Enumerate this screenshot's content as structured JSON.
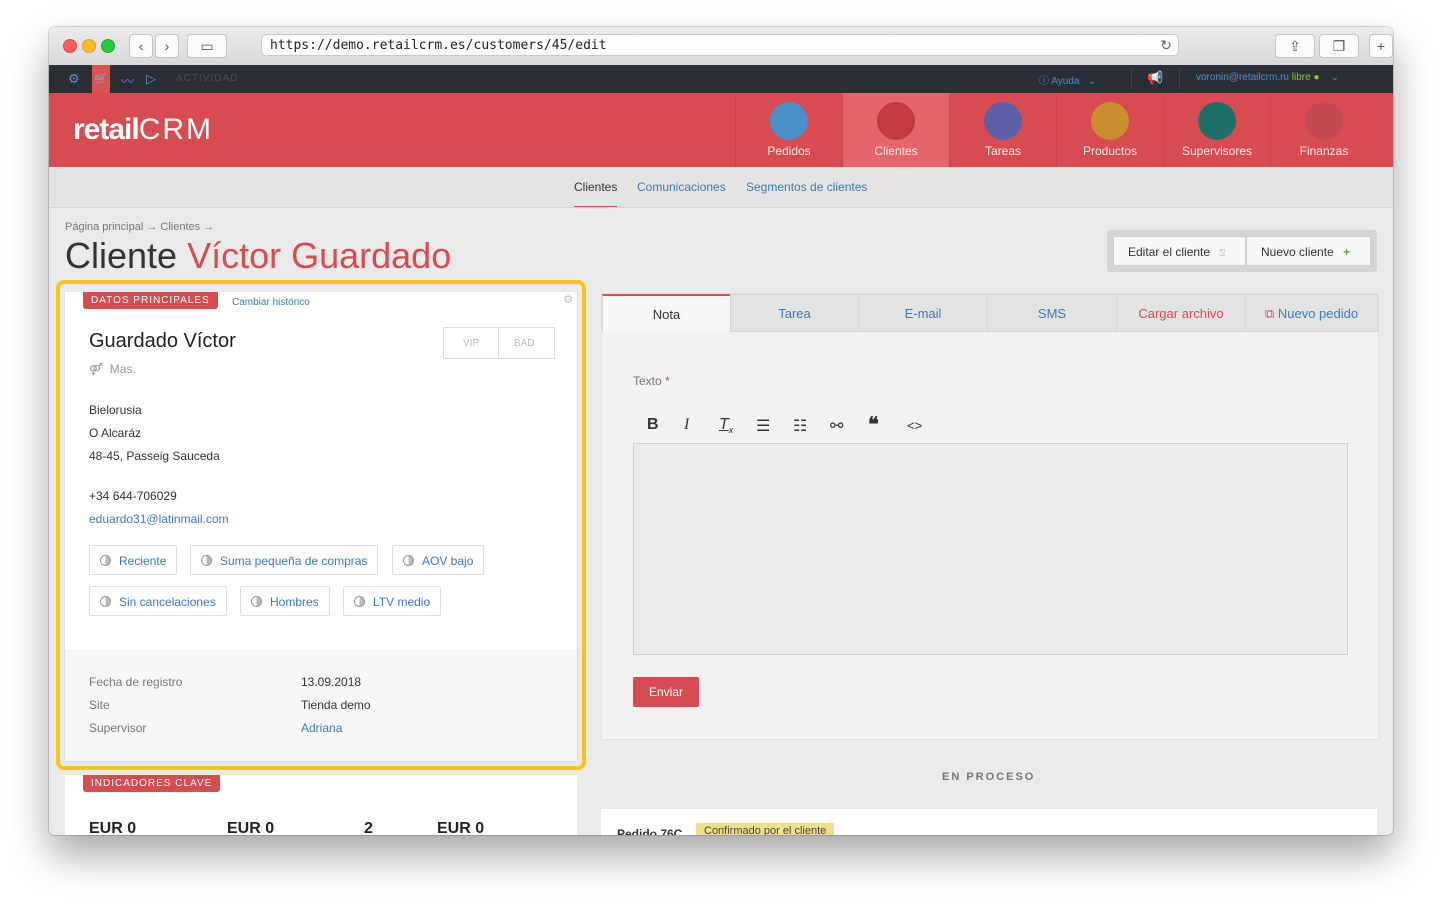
{
  "browser": {
    "url": "https://demo.retailcrm.es/customers/45/edit"
  },
  "topbar": {
    "activity": "ACTIVIDAD",
    "help": "Ayuda",
    "user": "voronin@retailcrm.ru",
    "status": "libre"
  },
  "header": {
    "logo_main": "retail",
    "logo_crm": "CRM",
    "nav": [
      {
        "label": "Pedidos",
        "icon": "cart-icon",
        "color": "#4a90c9"
      },
      {
        "label": "Clientes",
        "icon": "person-icon",
        "color": "#c03a40"
      },
      {
        "label": "Tareas",
        "icon": "chat-icon",
        "color": "#5b5fa8"
      },
      {
        "label": "Productos",
        "icon": "box-icon",
        "color": "#c98f2e"
      },
      {
        "label": "Supervisores",
        "icon": "supervisor-icon",
        "color": "#1d6f6a"
      },
      {
        "label": "Finanzas",
        "icon": "finance-icon",
        "color": "#c44a52"
      }
    ],
    "active_index": 1
  },
  "subnav": {
    "items": [
      "Clientes",
      "Comunicaciones",
      "Segmentos de clientes"
    ],
    "active_index": 0
  },
  "page": {
    "breadcrumb": "Página principal → Clientes →",
    "title_prefix": "Cliente",
    "title_name": "Víctor Guardado",
    "edit_button": "Editar el cliente",
    "new_button": "Nuevo cliente"
  },
  "customer": {
    "section_tag": "DATOS PRINCIPALES",
    "change_history": "Cambiar histórico",
    "name": "Guardado Víctor",
    "vip": "VIP",
    "bad": "BAD",
    "gender": "Mas.",
    "country": "Bielorusia",
    "city": "O Alcaráz",
    "address": "48-45, Passeig Sauceda",
    "phone": "+34 644-706029",
    "email": "eduardo31@latinmail.com",
    "segments": [
      "Reciente",
      "Suma pequeña de compras",
      "AOV bajo",
      "Sin cancelaciones",
      "Hombres",
      "LTV medio"
    ],
    "details": [
      {
        "key": "Fecha de registro",
        "value": "13.09.2018"
      },
      {
        "key": "Site",
        "value": "Tienda demo"
      },
      {
        "key": "Supervisor",
        "value": "Adriana"
      }
    ]
  },
  "kpis": {
    "section_tag": "INDICADORES CLAVE",
    "values": [
      "EUR 0",
      "EUR 0",
      "2",
      "EUR 0"
    ]
  },
  "editor": {
    "tabs": [
      "Nota",
      "Tarea",
      "E-mail",
      "SMS",
      "Cargar archivo",
      "Nuevo pedido"
    ],
    "active_index": 0,
    "field_label": "Texto",
    "required_mark": "*",
    "toolbar": [
      "B",
      "I",
      "Tx",
      "•≡",
      "1≡",
      "⛓",
      "❝",
      "<>"
    ],
    "send": "Enviar"
  },
  "orders": {
    "section": "EN PROCESO",
    "first_order": "Pedido 76C",
    "first_status": "Confirmado por el cliente"
  },
  "colors": {
    "brand": "#d74b51",
    "link": "#3d7ab8",
    "highlight": "#f5c518"
  }
}
